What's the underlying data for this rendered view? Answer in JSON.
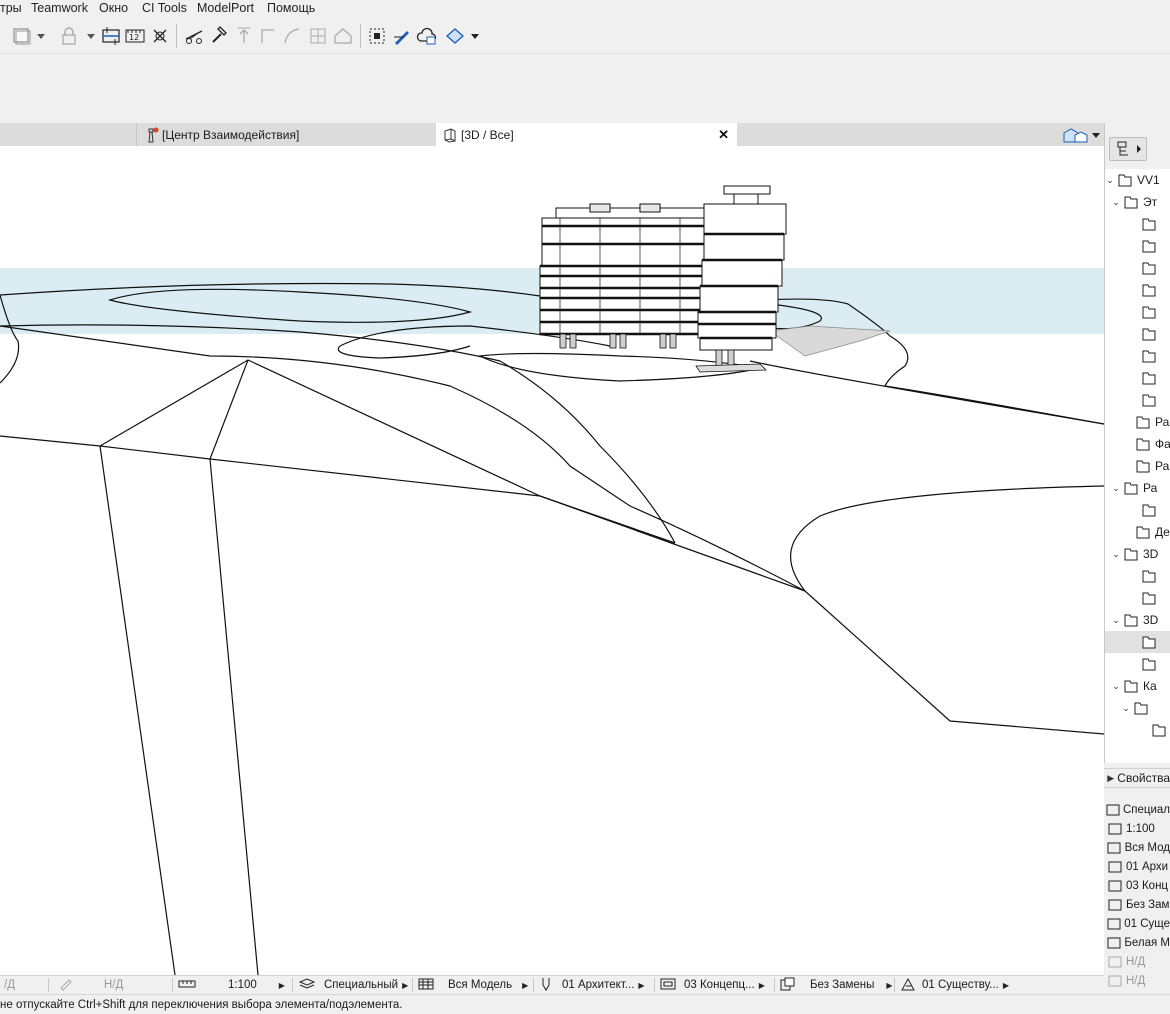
{
  "menu": [
    "тры",
    "Teamwork",
    "Окно",
    "CI Tools",
    "ModelPort",
    "Помощь"
  ],
  "tabs": {
    "center_label": "[Центр Взаимодействия]",
    "view3d_label": "[3D / Все]",
    "close_glyph": "✕"
  },
  "navigator": {
    "rows": [
      {
        "label": "VV1",
        "chev": "v",
        "icon": "house-icon"
      },
      {
        "label": "Эт",
        "chev": "v",
        "icon": "folder-icon"
      },
      {
        "label": "",
        "chev": "",
        "icon": "floor-icon"
      },
      {
        "label": "",
        "chev": "",
        "icon": "floor-icon"
      },
      {
        "label": "",
        "chev": "",
        "icon": "floor-icon"
      },
      {
        "label": "",
        "chev": "",
        "icon": "floor-icon"
      },
      {
        "label": "",
        "chev": "",
        "icon": "floor-icon"
      },
      {
        "label": "",
        "chev": "",
        "icon": "floor-icon"
      },
      {
        "label": "",
        "chev": "",
        "icon": "floor-icon"
      },
      {
        "label": "",
        "chev": "",
        "icon": "floor-icon"
      },
      {
        "label": "",
        "chev": "",
        "icon": "floor-icon"
      },
      {
        "label": "Ра",
        "chev": "",
        "icon": "section-icon"
      },
      {
        "label": "Фа",
        "chev": "",
        "icon": "elevation-icon"
      },
      {
        "label": "Ра",
        "chev": "",
        "icon": "interior-elevation-icon"
      },
      {
        "label": "Ра",
        "chev": "v",
        "icon": "worksheet-icon"
      },
      {
        "label": "",
        "chev": "",
        "icon": "worksheet-item-icon"
      },
      {
        "label": "Де",
        "chev": "",
        "icon": "detail-icon"
      },
      {
        "label": "3D",
        "chev": "v",
        "icon": "3d-document-icon"
      },
      {
        "label": "",
        "chev": "",
        "icon": "3d-document-item-icon"
      },
      {
        "label": "",
        "chev": "",
        "icon": "3d-document-item-icon"
      },
      {
        "label": "3D",
        "chev": "v",
        "icon": "3d-view-icon"
      },
      {
        "label": "",
        "chev": "",
        "icon": "3d-view-item-icon"
      },
      {
        "label": "",
        "chev": "",
        "icon": "3d-cube-icon"
      },
      {
        "label": "Ка",
        "chev": "v",
        "icon": "schedule-icon"
      },
      {
        "label": "",
        "chev": "v",
        "icon": "hatch-icon"
      },
      {
        "label": "",
        "chev": "",
        "icon": "table-icon"
      }
    ],
    "selected_index": 21
  },
  "properties": {
    "header": "Свойства",
    "rows": [
      {
        "label": "Специал",
        "icon": "layers-icon"
      },
      {
        "label": "1:100",
        "icon": "scale-icon"
      },
      {
        "label": "Вся Мод",
        "icon": "structure-icon"
      },
      {
        "label": "01 Архи",
        "icon": "pen-set-icon"
      },
      {
        "label": "03 Конц",
        "icon": "model-view-icon"
      },
      {
        "label": "Без Зам",
        "icon": "override-icon"
      },
      {
        "label": "01 Суще",
        "icon": "renovation-icon"
      },
      {
        "label": "Белая М",
        "icon": "3d-style-icon"
      },
      {
        "label": "Н/Д",
        "icon": "target-icon",
        "muted": true
      },
      {
        "label": "Н/Д",
        "icon": "pencil-icon",
        "muted": true
      }
    ]
  },
  "statusbar": {
    "nd1": "/Д",
    "nd2": "Н/Д",
    "scale": "1:100",
    "layers": "Специальный",
    "structure": "Вся Модель",
    "pen_set": "01 Архитект...",
    "model_view": "03 Концепц...",
    "override": "Без Замены",
    "renovation": "01 Существу..."
  },
  "hint": "не отпускайте Ctrl+Shift для переключения выбора элемента/подэлемента."
}
